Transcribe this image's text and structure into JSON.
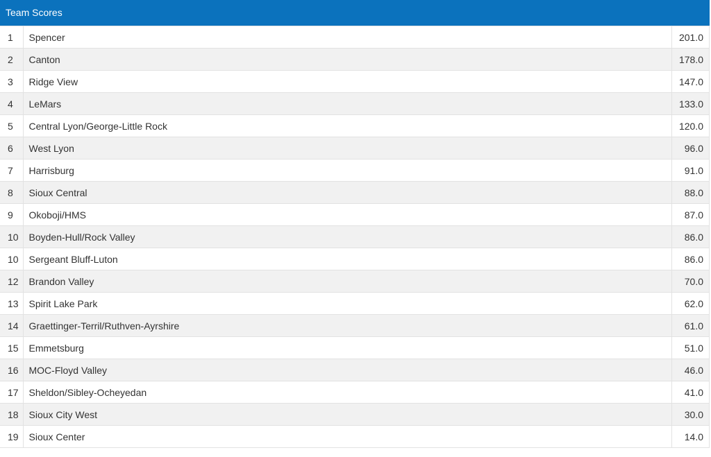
{
  "panel": {
    "title": "Team Scores"
  },
  "rows": [
    {
      "place": "1",
      "team": "Spencer",
      "score": "201.0"
    },
    {
      "place": "2",
      "team": "Canton",
      "score": "178.0"
    },
    {
      "place": "3",
      "team": "Ridge View",
      "score": "147.0"
    },
    {
      "place": "4",
      "team": "LeMars",
      "score": "133.0"
    },
    {
      "place": "5",
      "team": "Central Lyon/George-Little Rock",
      "score": "120.0"
    },
    {
      "place": "6",
      "team": "West Lyon",
      "score": "96.0"
    },
    {
      "place": "7",
      "team": "Harrisburg",
      "score": "91.0"
    },
    {
      "place": "8",
      "team": "Sioux Central",
      "score": "88.0"
    },
    {
      "place": "9",
      "team": "Okoboji/HMS",
      "score": "87.0"
    },
    {
      "place": "10",
      "team": "Boyden-Hull/Rock Valley",
      "score": "86.0"
    },
    {
      "place": "10",
      "team": "Sergeant Bluff-Luton",
      "score": "86.0"
    },
    {
      "place": "12",
      "team": "Brandon Valley",
      "score": "70.0"
    },
    {
      "place": "13",
      "team": "Spirit Lake Park",
      "score": "62.0"
    },
    {
      "place": "14",
      "team": "Graettinger-Terril/Ruthven-Ayrshire",
      "score": "61.0"
    },
    {
      "place": "15",
      "team": "Emmetsburg",
      "score": "51.0"
    },
    {
      "place": "16",
      "team": "MOC-Floyd Valley",
      "score": "46.0"
    },
    {
      "place": "17",
      "team": "Sheldon/Sibley-Ocheyedan",
      "score": "41.0"
    },
    {
      "place": "18",
      "team": "Sioux City West",
      "score": "30.0"
    },
    {
      "place": "19",
      "team": "Sioux Center",
      "score": "14.0"
    }
  ]
}
